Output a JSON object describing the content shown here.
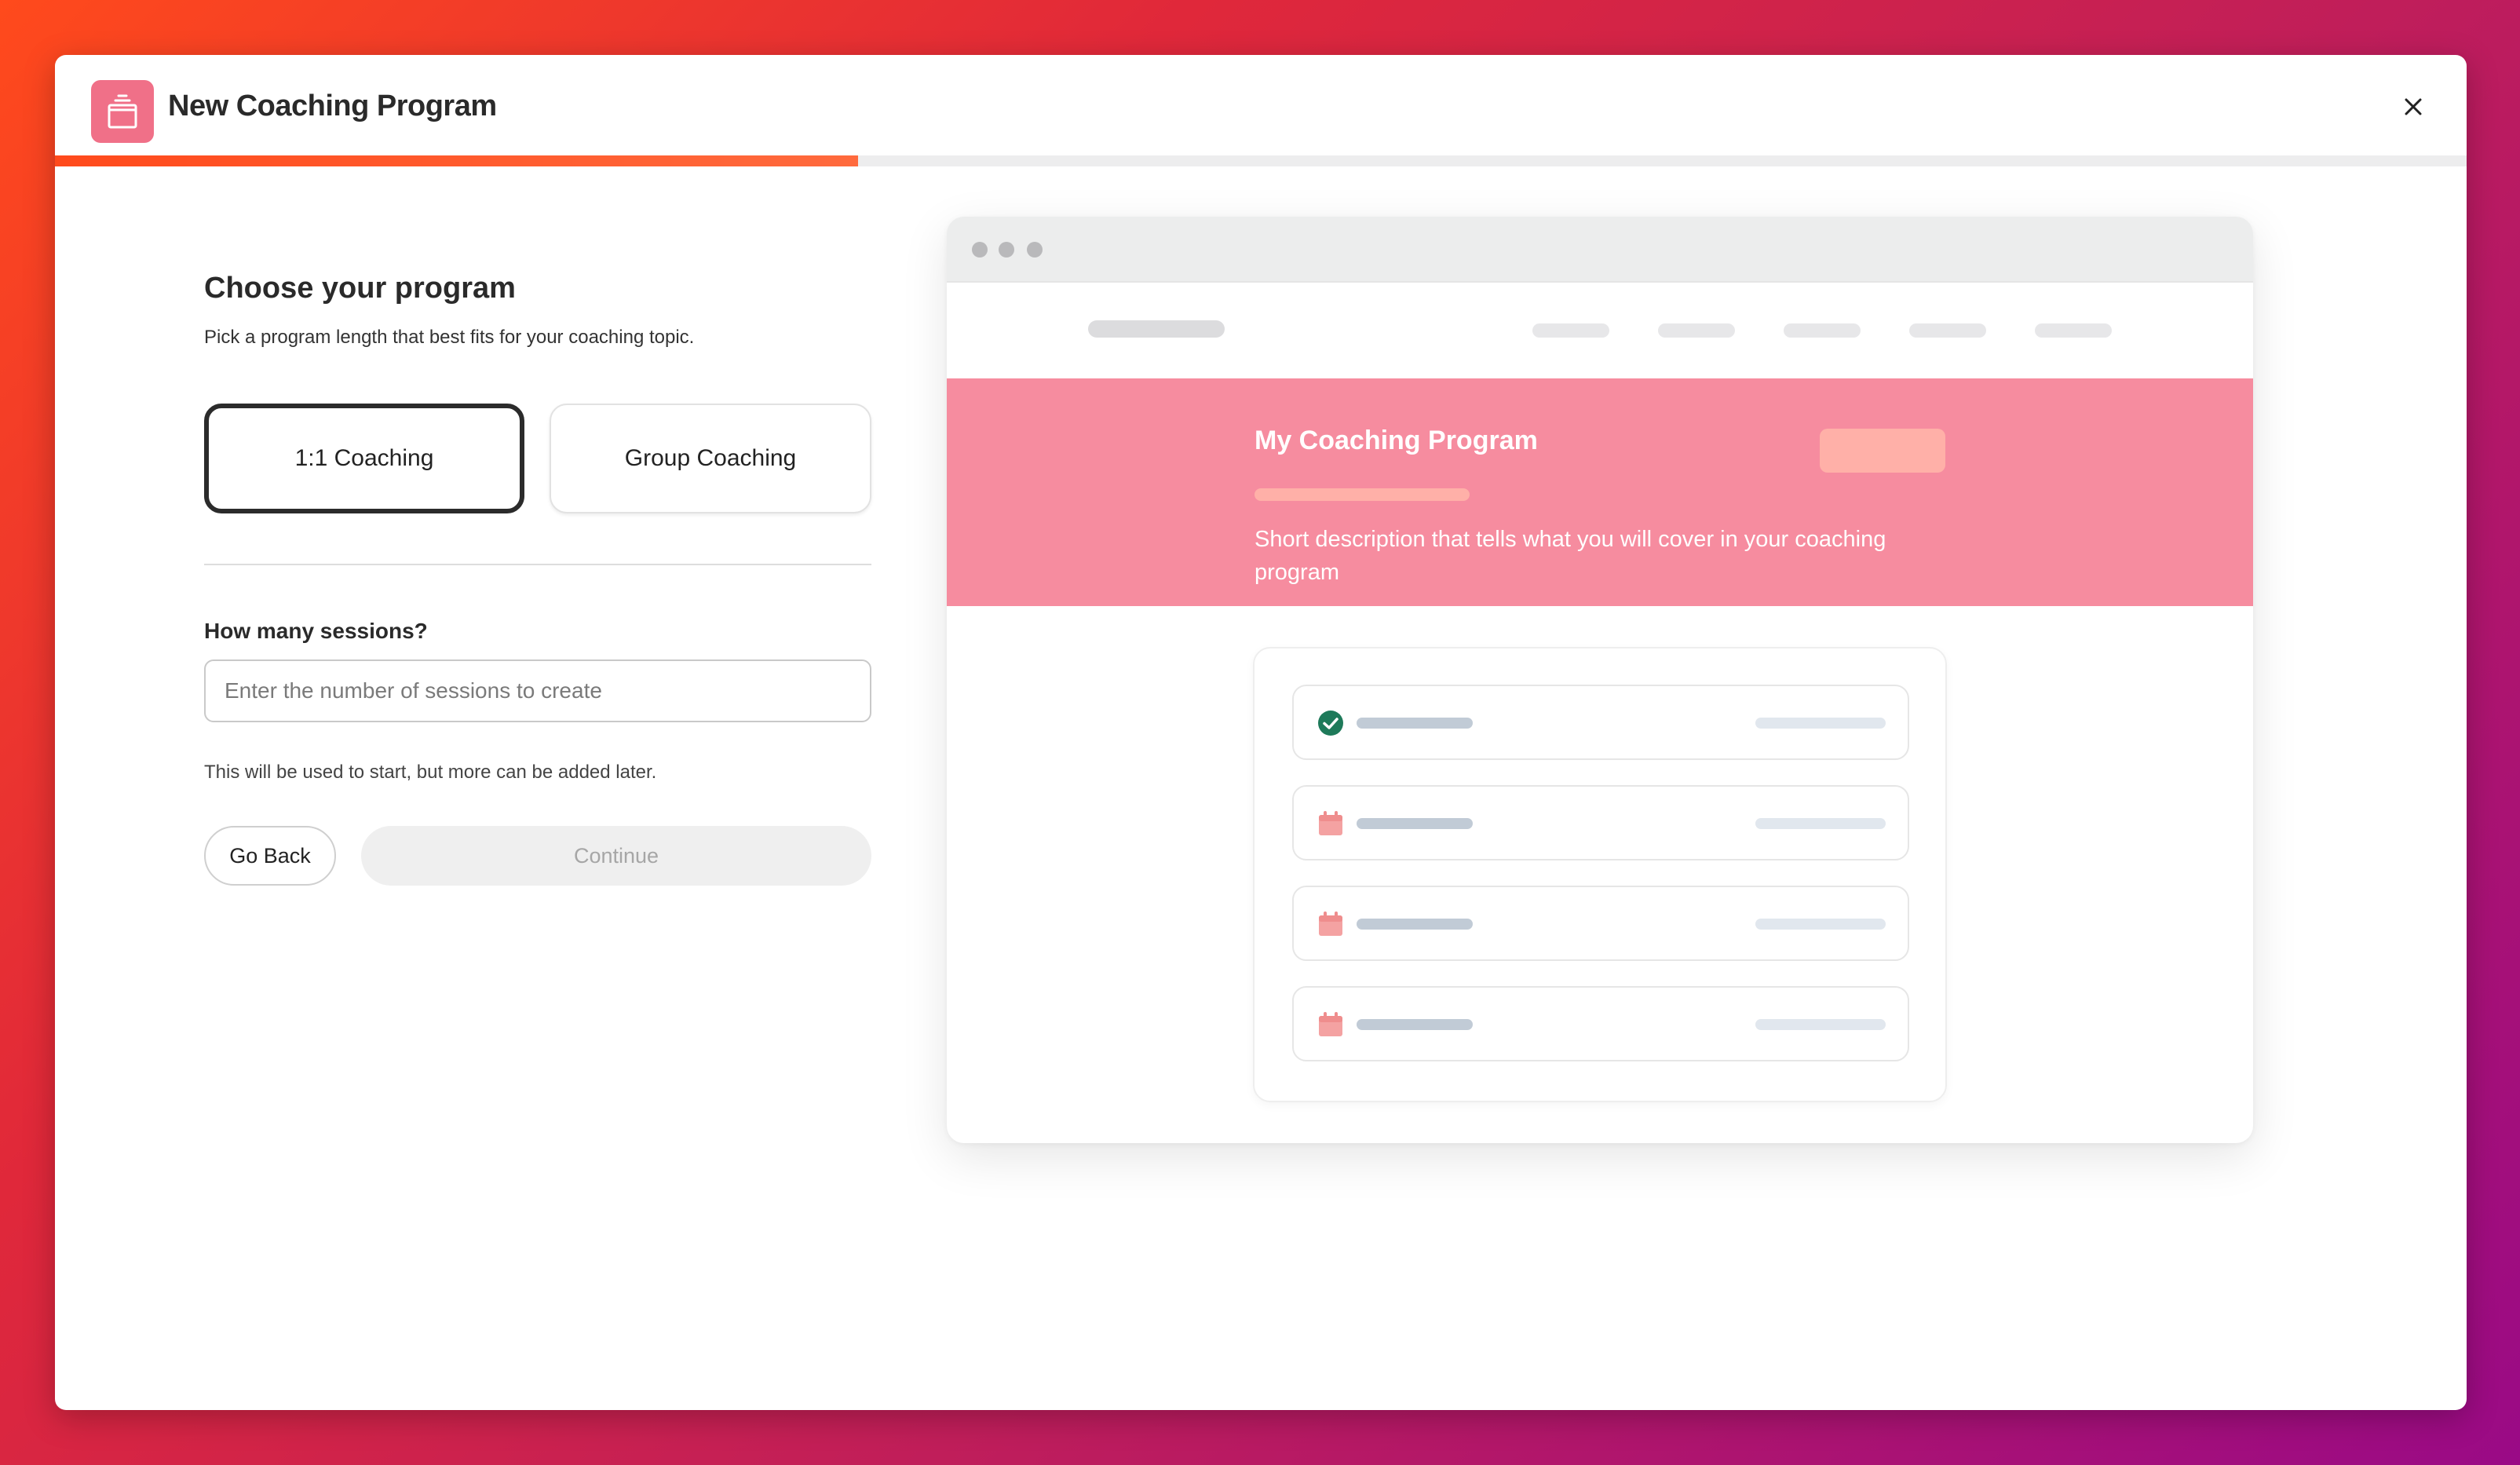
{
  "modal": {
    "title": "New Coaching Program",
    "close_label": "×",
    "progress": 0.333
  },
  "step": {
    "title": "Choose your program",
    "subtitle": "Pick a program length that best fits for your coaching topic.",
    "options": [
      {
        "label": "1:1 Coaching",
        "selected": true
      },
      {
        "label": "Group Coaching",
        "selected": false
      }
    ],
    "sessions": {
      "label": "How many sessions?",
      "value": "",
      "placeholder": "Enter the number of sessions to create",
      "hint": "This will be used to start, but more can be added later."
    },
    "back_label": "Go Back",
    "continue_label": "Continue"
  },
  "preview": {
    "hero_title": "My Coaching Program",
    "hero_description": "Short description that tells what you will cover in your coaching program",
    "rows": [
      {
        "icon": "check-circle-icon",
        "status": "completed"
      },
      {
        "icon": "calendar-icon",
        "status": "scheduled"
      },
      {
        "icon": "calendar-icon",
        "status": "scheduled"
      },
      {
        "icon": "calendar-icon",
        "status": "scheduled"
      }
    ]
  },
  "colors": {
    "accent": "#ff4a1c",
    "hero": "#f68c9f",
    "app_icon": "#f07088",
    "check": "#1e7a5a",
    "calendar": "#f4a2a2"
  }
}
